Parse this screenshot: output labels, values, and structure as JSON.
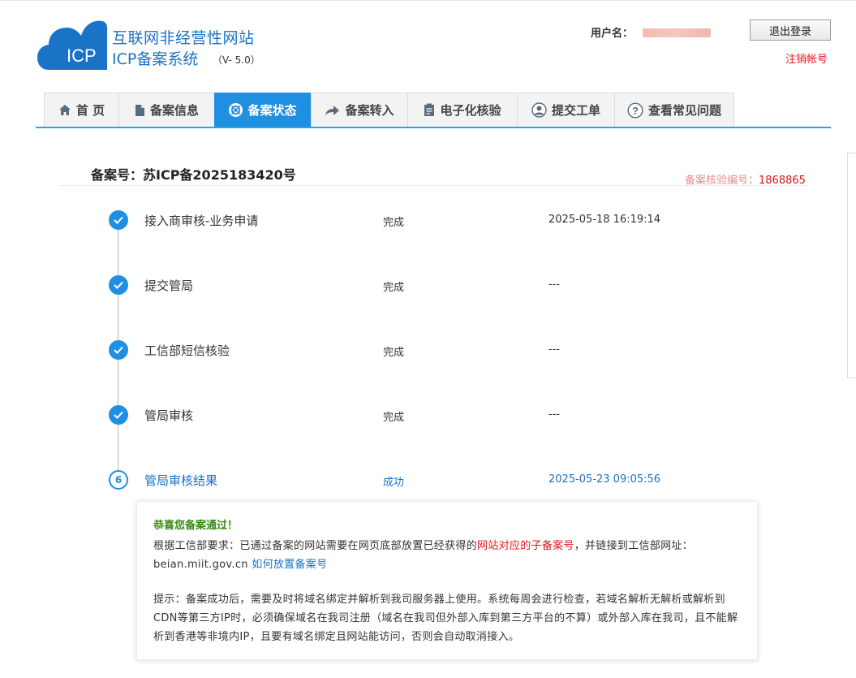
{
  "header": {
    "site_title": "互联网非经营性网站",
    "system_title": "ICP备案系统",
    "version": "（V- 5.0）",
    "logo_text": "ICP",
    "user_label": "用户名：",
    "logout_label": "退出登录",
    "cancel_account_label": "注销帐号"
  },
  "nav": {
    "tabs": [
      {
        "label": "首 页",
        "icon": "home-icon"
      },
      {
        "label": "备案信息",
        "icon": "document-icon"
      },
      {
        "label": "备案状态",
        "icon": "lifebuoy-icon",
        "active": true
      },
      {
        "label": "备案转入",
        "icon": "share-arrow-icon"
      },
      {
        "label": "电子化核验",
        "icon": "clipboard-icon"
      },
      {
        "label": "提交工单",
        "icon": "user-icon"
      },
      {
        "label": "查看常见问题",
        "icon": "help-icon"
      }
    ]
  },
  "record": {
    "number_text": "备案号：苏ICP备2025183420号",
    "verify_label": "备案核验编号：",
    "verify_value": "1868865"
  },
  "steps": [
    {
      "name": "接入商审核-业务申请",
      "status": "完成",
      "time": "2025-05-18 16:19:14",
      "done": true
    },
    {
      "name": "提交管局",
      "status": "完成",
      "time": "---",
      "done": true
    },
    {
      "name": "工信部短信核验",
      "status": "完成",
      "time": "---",
      "done": true
    },
    {
      "name": "管局审核",
      "status": "完成",
      "time": "---",
      "done": true
    },
    {
      "name": "管局审核结果",
      "status": "成功",
      "time": "2025-05-23 09:05:56",
      "done": false,
      "number": "6"
    }
  ],
  "notice": {
    "title": "恭喜您备案通过！",
    "p1_before": "根据工信部要求：已通过备案的网站需要在网页底部放置已经获得的",
    "p1_highlight": "网站对应的子备案号",
    "p1_after": "，并链接到工信部网址：beian.miit.gov.cn ",
    "p1_link": "如何放置备案号",
    "p2": "提示：备案成功后，需要及时将域名绑定并解析到我司服务器上使用。系统每周会进行检查，若域名解析无解析或解析到CDN等第三方IP时，必须确保域名在我司注册（域名在我司但外部入库到第三方平台的不算）或外部入库在我司，且不能解析到香港等非境内IP，且要有域名绑定且网站能访问，否则会自动取消接入。"
  },
  "colors": {
    "accent": "#1e8fe1",
    "brand_text": "#1a73c7",
    "danger": "#e4151b",
    "success_title": "#3a8a16"
  }
}
